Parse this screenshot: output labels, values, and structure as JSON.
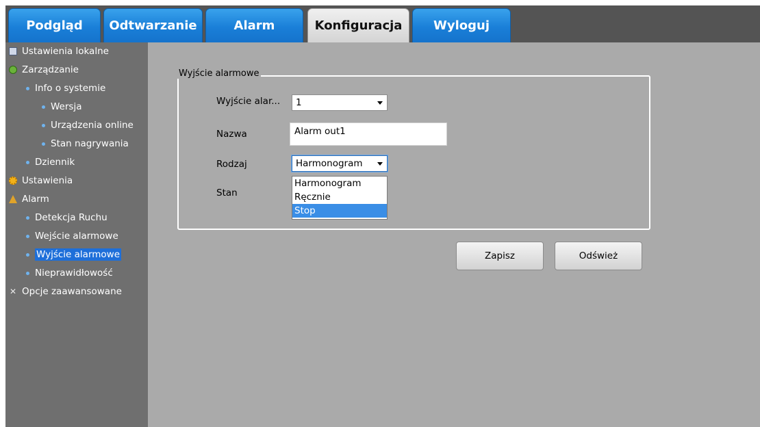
{
  "nav": {
    "tabs": [
      {
        "label": "Podgląd",
        "active": false
      },
      {
        "label": "Odtwarzanie",
        "active": false
      },
      {
        "label": "Alarm",
        "active": false
      },
      {
        "label": "Konfiguracja",
        "active": true
      },
      {
        "label": "Wyloguj",
        "active": false
      }
    ]
  },
  "sidebar": {
    "items": [
      {
        "label": "Ustawienia lokalne",
        "icon": "local-settings-icon"
      },
      {
        "label": "Zarządzanie",
        "icon": "management-icon"
      },
      {
        "label": "Info o systemie",
        "icon": "bullet-icon"
      },
      {
        "label": "Wersja",
        "icon": "bullet-icon"
      },
      {
        "label": "Urządzenia online",
        "icon": "bullet-icon"
      },
      {
        "label": "Stan nagrywania",
        "icon": "bullet-icon"
      },
      {
        "label": "Dziennik",
        "icon": "bullet-icon"
      },
      {
        "label": "Ustawienia",
        "icon": "settings-icon"
      },
      {
        "label": "Alarm",
        "icon": "alarm-icon"
      },
      {
        "label": "Detekcja Ruchu",
        "icon": "bullet-icon"
      },
      {
        "label": "Wejście alarmowe",
        "icon": "bullet-icon"
      },
      {
        "label": "Wyjście alarmowe",
        "icon": "bullet-icon",
        "selected": true
      },
      {
        "label": "Nieprawidłowość",
        "icon": "bullet-icon"
      },
      {
        "label": "Opcje zaawansowane",
        "icon": "advanced-options-icon"
      }
    ]
  },
  "form": {
    "legend": "Wyjście alarmowe",
    "output_label": "Wyjście alar...",
    "output_value": "1",
    "name_label": "Nazwa",
    "name_value": "Alarm out1",
    "type_label": "Rodzaj",
    "type_value": "Harmonogram",
    "status_label": "Stan",
    "type_options": [
      "Harmonogram",
      "Ręcznie",
      "Stop"
    ],
    "highlighted_option": "Stop"
  },
  "buttons": {
    "save": "Zapisz",
    "refresh": "Odśwież"
  },
  "colors": {
    "tab_blue": "#1a7fd8",
    "sidebar_bg": "#6f6f6f",
    "content_bg": "#aaaaaa",
    "selection_blue": "#1e6fd9"
  }
}
